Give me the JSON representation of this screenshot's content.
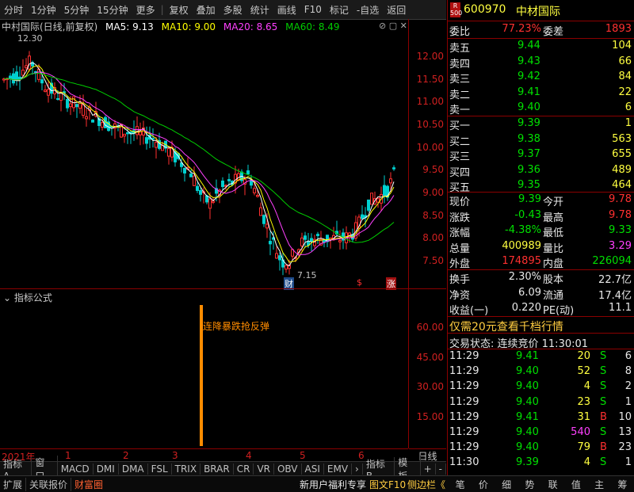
{
  "toolbar": [
    "分时",
    "1分钟",
    "5分钟",
    "15分钟",
    "更多",
    "复权",
    "叠加",
    "多股",
    "统计",
    "画线",
    "F10",
    "标记",
    "-自选",
    "返回"
  ],
  "chart": {
    "stock_title": "中村国际(日线,前复权)",
    "ma5": "MA5: 9.13",
    "ma10": "MA10: 9.00",
    "ma20": "MA20: 8.65",
    "ma60": "MA60: 8.49",
    "high_label": "12.30",
    "low_label": "7.15",
    "marker_cai": "财",
    "marker_s": "$",
    "marker_zhang": "涨",
    "yticks": [
      "12.00",
      "11.50",
      "11.00",
      "10.50",
      "10.00",
      "9.50",
      "9.00",
      "8.50",
      "8.00",
      "7.50"
    ],
    "indicator_title": "指标公式",
    "indicator_text": "连降暴跌抢反弹",
    "ind_yticks": [
      "60.00",
      "45.00",
      "30.00",
      "15.00"
    ],
    "x_year": "2021年",
    "x_months": [
      "1",
      "2",
      "3",
      "4",
      "5",
      "6"
    ],
    "period_btn": "日线",
    "colors": {
      "ma5": "#ffffff",
      "ma10": "#ffff00",
      "ma20": "#ff40ff",
      "ma60": "#00cc00",
      "up": "#ff3030",
      "down": "#00d0d0"
    }
  },
  "tabs": [
    "指标A",
    "窗口",
    "MACD",
    "DMI",
    "DMA",
    "FSL",
    "TRIX",
    "BRAR",
    "CR",
    "VR",
    "OBV",
    "ASI",
    "EMV",
    "›",
    "指标B",
    "模板",
    "+",
    "-"
  ],
  "bottom": {
    "left": [
      "扩展",
      "关联报价",
      "财富圈"
    ],
    "mid": "新用户福利专享",
    "right": [
      "图文F10",
      "侧边栏《"
    ],
    "panel_tabs": [
      "笔",
      "价",
      "细",
      "势",
      "联",
      "值",
      "主",
      "筹"
    ]
  },
  "quote": {
    "badge_top": "R",
    "badge_bot": "500",
    "code": "600970",
    "name": "中材国际",
    "weibi_label": "委比",
    "weibi": "77.23%",
    "weicha_label": "委差",
    "weicha": "1893",
    "sell": [
      {
        "label": "卖五",
        "price": "9.44",
        "vol": "104"
      },
      {
        "label": "卖四",
        "price": "9.43",
        "vol": "66"
      },
      {
        "label": "卖三",
        "price": "9.42",
        "vol": "84"
      },
      {
        "label": "卖二",
        "price": "9.41",
        "vol": "22"
      },
      {
        "label": "卖一",
        "price": "9.40",
        "vol": "6"
      }
    ],
    "buy": [
      {
        "label": "买一",
        "price": "9.39",
        "vol": "1"
      },
      {
        "label": "买二",
        "price": "9.38",
        "vol": "563"
      },
      {
        "label": "买三",
        "price": "9.37",
        "vol": "655"
      },
      {
        "label": "买四",
        "price": "9.36",
        "vol": "489"
      },
      {
        "label": "买五",
        "price": "9.35",
        "vol": "464"
      }
    ],
    "stats": [
      {
        "l1": "现价",
        "v1": "9.39",
        "l2": "今开",
        "v2": "9.78"
      },
      {
        "l1": "涨跌",
        "v1": "-0.43",
        "l2": "最高",
        "v2": "9.78"
      },
      {
        "l1": "涨幅",
        "v1": "-4.38%",
        "l2": "最低",
        "v2": "9.33"
      },
      {
        "l1": "总量",
        "v1": "400989",
        "l2": "量比",
        "v2": "3.29"
      },
      {
        "l1": "外盘",
        "v1": "174895",
        "l2": "内盘",
        "v2": "226094"
      }
    ],
    "fund": [
      {
        "l1": "换手",
        "v1": "2.30%",
        "l2": "股本",
        "v2": "22.7亿"
      },
      {
        "l1": "净资",
        "v1": "6.09",
        "l2": "流通",
        "v2": "17.4亿"
      },
      {
        "l1": "收益(一)",
        "v1": "0.220",
        "l2": "PE(动)",
        "v2": "11.1"
      }
    ],
    "promo": "仅需20元查看千档行情",
    "status": "交易状态: 连续竞价  11:30:01",
    "ticks": [
      {
        "t": "11:29",
        "p": "9.41",
        "v": "20",
        "bs": "S",
        "n": "6"
      },
      {
        "t": "11:29",
        "p": "9.40",
        "v": "52",
        "bs": "S",
        "n": "8"
      },
      {
        "t": "11:29",
        "p": "9.40",
        "v": "4",
        "bs": "S",
        "n": "2"
      },
      {
        "t": "11:29",
        "p": "9.40",
        "v": "23",
        "bs": "S",
        "n": "1"
      },
      {
        "t": "11:29",
        "p": "9.41",
        "v": "31",
        "bs": "B",
        "n": "10"
      },
      {
        "t": "11:29",
        "p": "9.40",
        "v": "540",
        "bs": "S",
        "n": "13"
      },
      {
        "t": "11:29",
        "p": "9.40",
        "v": "79",
        "bs": "B",
        "n": "23"
      },
      {
        "t": "11:30",
        "p": "9.39",
        "v": "4",
        "bs": "S",
        "n": "1"
      }
    ]
  }
}
